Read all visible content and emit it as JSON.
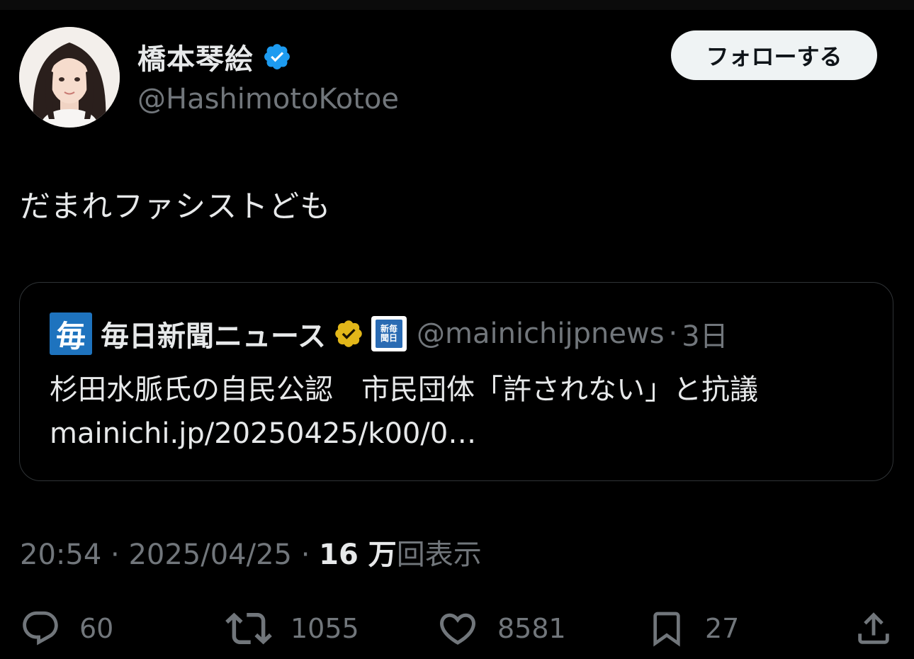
{
  "author": {
    "display_name": "橋本琴絵",
    "handle": "@HashimotoKotoe",
    "verified_icon": "blue-verified-badge",
    "avatar_icon": "profile-photo"
  },
  "follow_button_label": "フォローする",
  "tweet": {
    "text": "だまれファシストども"
  },
  "quote": {
    "logo_char": "毎",
    "name": "毎日新聞ニュース",
    "badge_icon": "gold-verified-badge",
    "affiliate_lines": [
      "新毎",
      "聞日"
    ],
    "handle": "@mainichijpnews",
    "separator": "·",
    "time": "3日",
    "headline": "杉田水脈氏の自民公認　市民団体「許されない」と抗議",
    "link": "mainichi.jp/20250425/k00/0…"
  },
  "meta": {
    "time": "20:54",
    "sep1": " · ",
    "date": "2025/04/25",
    "sep2": " · ",
    "views_count": "16 万",
    "views_label": "回表示"
  },
  "actions": {
    "reply_count": "60",
    "repost_count": "1055",
    "like_count": "8581",
    "bookmark_count": "27"
  },
  "colors": {
    "background": "#000000",
    "text_primary": "#e7e9ea",
    "text_secondary": "#71767b",
    "verified_blue": "#1d9bf0",
    "verified_gold": "#e2b719",
    "border": "#2f3336"
  }
}
